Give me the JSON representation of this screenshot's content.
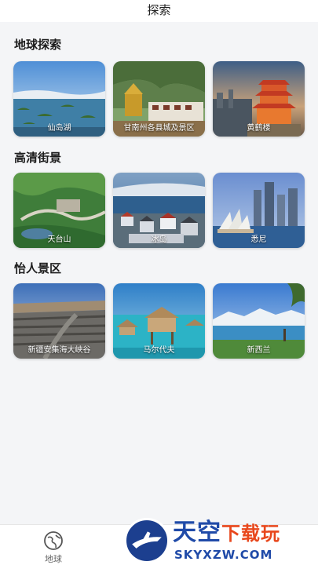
{
  "header": {
    "title": "探索"
  },
  "sections": [
    {
      "title": "地球探索",
      "cards": [
        {
          "label": "仙岛湖"
        },
        {
          "label": "甘南州各县城及景区"
        },
        {
          "label": "黄鹤楼"
        }
      ]
    },
    {
      "title": "高清街景",
      "cards": [
        {
          "label": "天台山"
        },
        {
          "label": "冰岛"
        },
        {
          "label": "悉尼"
        }
      ]
    },
    {
      "title": "怡人景区",
      "cards": [
        {
          "label": "新疆安集海大峡谷"
        },
        {
          "label": "马尔代夫"
        },
        {
          "label": "新西兰"
        }
      ]
    }
  ],
  "tabbar": {
    "earth_label": "地球",
    "earth_icon": "earth-icon"
  },
  "watermark": {
    "title_main": "天空",
    "title_accent": "下载玩",
    "url": "SKYXZW.COM"
  }
}
